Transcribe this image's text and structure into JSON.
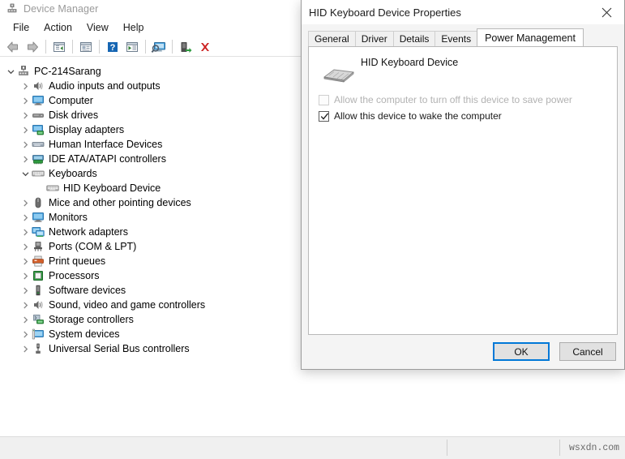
{
  "device_manager": {
    "title": "Device Manager",
    "title_icon": "device-manager-icon",
    "menu": [
      {
        "label": "File"
      },
      {
        "label": "Action"
      },
      {
        "label": "View"
      },
      {
        "label": "Help"
      }
    ],
    "toolbar": [
      {
        "name": "back-icon"
      },
      {
        "name": "forward-icon"
      },
      {
        "name": "separator"
      },
      {
        "name": "show-hide-console-tree-icon"
      },
      {
        "name": "separator"
      },
      {
        "name": "properties-icon"
      },
      {
        "name": "separator"
      },
      {
        "name": "help-icon"
      },
      {
        "name": "update-driver-icon"
      },
      {
        "name": "separator"
      },
      {
        "name": "scan-for-hardware-changes-icon"
      },
      {
        "name": "separator"
      },
      {
        "name": "add-legacy-hardware-icon"
      },
      {
        "name": "uninstall-device-icon"
      }
    ],
    "tree": [
      {
        "label": "PC-214Sarang",
        "icon": "computer-root-icon",
        "indent": 0,
        "expander": "expanded"
      },
      {
        "label": "Audio inputs and outputs",
        "icon": "speaker-icon",
        "indent": 1,
        "expander": "collapsed"
      },
      {
        "label": "Computer",
        "icon": "monitor-icon",
        "indent": 1,
        "expander": "collapsed"
      },
      {
        "label": "Disk drives",
        "icon": "disk-drive-icon",
        "indent": 1,
        "expander": "collapsed"
      },
      {
        "label": "Display adapters",
        "icon": "display-adapter-icon",
        "indent": 1,
        "expander": "collapsed"
      },
      {
        "label": "Human Interface Devices",
        "icon": "hid-icon",
        "indent": 1,
        "expander": "collapsed"
      },
      {
        "label": "IDE ATA/ATAPI controllers",
        "icon": "ide-controller-icon",
        "indent": 1,
        "expander": "collapsed"
      },
      {
        "label": "Keyboards",
        "icon": "keyboard-icon",
        "indent": 1,
        "expander": "expanded"
      },
      {
        "label": "HID Keyboard Device",
        "icon": "keyboard-icon",
        "indent": 2,
        "expander": "none"
      },
      {
        "label": "Mice and other pointing devices",
        "icon": "mouse-icon",
        "indent": 1,
        "expander": "collapsed"
      },
      {
        "label": "Monitors",
        "icon": "monitor-icon",
        "indent": 1,
        "expander": "collapsed"
      },
      {
        "label": "Network adapters",
        "icon": "network-adapter-icon",
        "indent": 1,
        "expander": "collapsed"
      },
      {
        "label": "Ports (COM & LPT)",
        "icon": "port-icon",
        "indent": 1,
        "expander": "collapsed"
      },
      {
        "label": "Print queues",
        "icon": "printer-icon",
        "indent": 1,
        "expander": "collapsed"
      },
      {
        "label": "Processors",
        "icon": "processor-icon",
        "indent": 1,
        "expander": "collapsed"
      },
      {
        "label": "Software devices",
        "icon": "software-device-icon",
        "indent": 1,
        "expander": "collapsed"
      },
      {
        "label": "Sound, video and game controllers",
        "icon": "speaker-icon",
        "indent": 1,
        "expander": "collapsed"
      },
      {
        "label": "Storage controllers",
        "icon": "storage-controller-icon",
        "indent": 1,
        "expander": "collapsed"
      },
      {
        "label": "System devices",
        "icon": "system-device-icon",
        "indent": 1,
        "expander": "collapsed"
      },
      {
        "label": "Universal Serial Bus controllers",
        "icon": "usb-controller-icon",
        "indent": 1,
        "expander": "collapsed"
      }
    ],
    "statusbar": {
      "left_text": "",
      "middle_text": "",
      "watermark": "wsxdn.com"
    }
  },
  "dialog": {
    "title": "HID Keyboard Device Properties",
    "close_icon": "close-icon",
    "tabs": [
      {
        "label": "General",
        "active": false
      },
      {
        "label": "Driver",
        "active": false
      },
      {
        "label": "Details",
        "active": false
      },
      {
        "label": "Events",
        "active": false
      },
      {
        "label": "Power Management",
        "active": true
      }
    ],
    "device": {
      "name": "HID Keyboard Device",
      "icon": "keyboard-3d-icon"
    },
    "checkboxes": [
      {
        "label": "Allow the computer to turn off this device to save power",
        "checked": false,
        "disabled": true
      },
      {
        "label": "Allow this device to wake the computer",
        "checked": true,
        "disabled": false
      }
    ],
    "buttons": [
      {
        "label": "OK",
        "default": true
      },
      {
        "label": "Cancel",
        "default": false
      }
    ]
  },
  "colors": {
    "accent": "#0078d7",
    "uninstall_red": "#cc2020",
    "icon_blue": "#4aa3df",
    "dialog_bg": "#f4f4f4"
  }
}
